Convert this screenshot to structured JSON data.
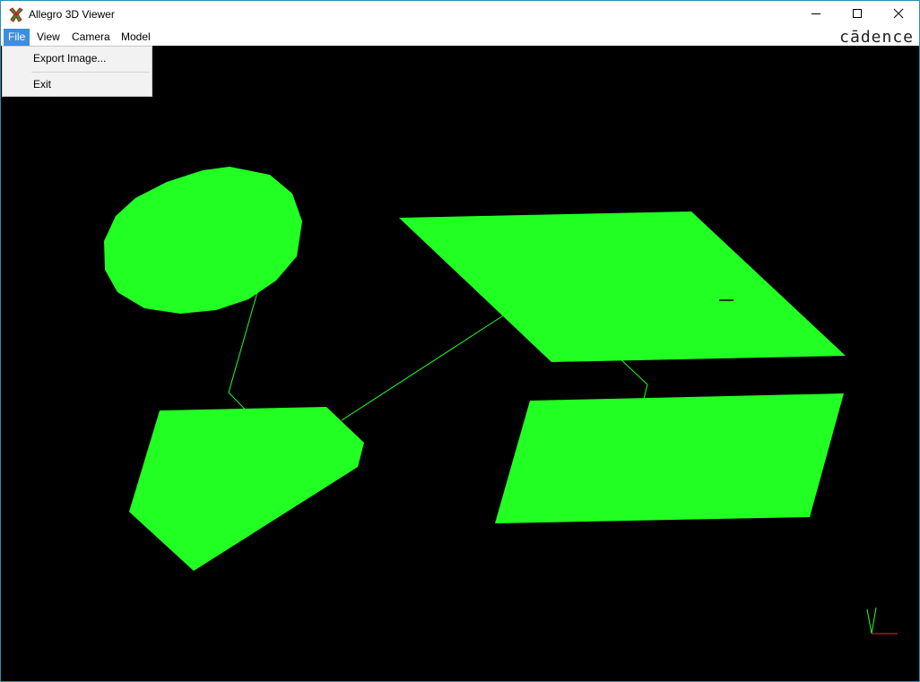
{
  "window": {
    "title": "Allegro 3D Viewer",
    "app_icon": "allegro-app-icon",
    "controls": {
      "minimize_icon": "minimize-icon",
      "maximize_icon": "maximize-icon",
      "close_icon": "close-icon"
    }
  },
  "menubar": {
    "items": [
      {
        "label": "File",
        "active": true
      },
      {
        "label": "View",
        "active": false
      },
      {
        "label": "Camera",
        "active": false
      },
      {
        "label": "Model",
        "active": false
      }
    ],
    "brand": "cādence"
  },
  "file_menu": {
    "items": [
      {
        "label": "Export Image..."
      },
      {
        "label": "Exit"
      }
    ]
  },
  "viewport": {
    "background": "#000000",
    "shape_color": "#22ff22",
    "trace_color": "#22ff22",
    "axis_colors": {
      "x": "#ff0000",
      "y": "#00ff00"
    }
  }
}
